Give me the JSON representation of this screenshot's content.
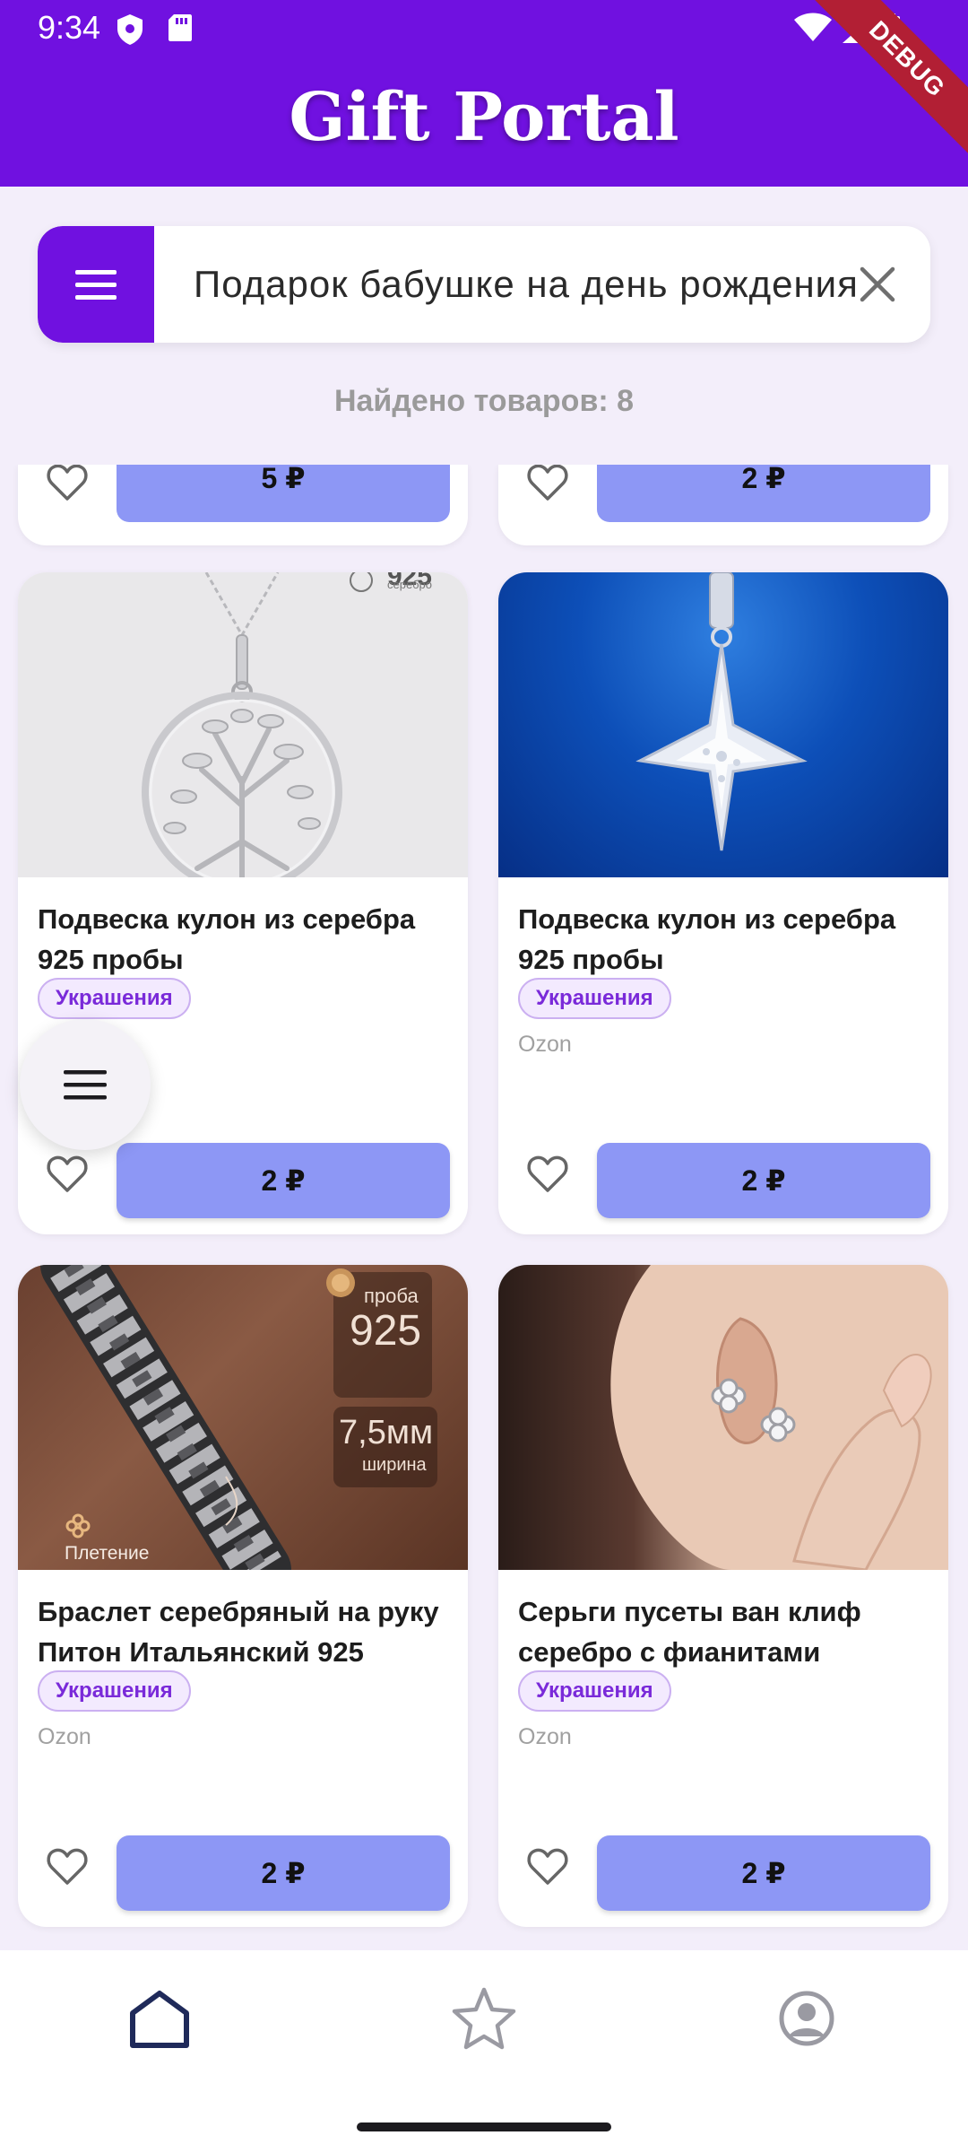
{
  "status_bar": {
    "time": "9:34"
  },
  "app_bar": {
    "title": "Gift Portal",
    "debug_banner": "DEBUG"
  },
  "search": {
    "query": "Подарок бабушке на день рождения"
  },
  "results": {
    "found_text": "Найдено товаров: 8"
  },
  "partial_row": [
    {
      "price": "5 ₽"
    },
    {
      "price": "2 ₽"
    }
  ],
  "products": [
    {
      "name": "Подвеска кулон из серебра 925 пробы",
      "category": "Украшения",
      "store": "",
      "price": "2 ₽",
      "image": "silver-tree-of-life-pendant"
    },
    {
      "name": "Подвеска кулон из серебра 925 пробы",
      "category": "Украшения",
      "store": "Ozon",
      "price": "2 ₽",
      "image": "silver-star-pendant"
    },
    {
      "name": "Браслет серебряный на руку Питон Итальянский 925",
      "category": "Украшения",
      "store": "Ozon",
      "price": "2 ₽",
      "image": "silver-chain-bracelet",
      "overlay": {
        "probe_label": "проба",
        "probe_value": "925",
        "width_value": "7,5мм",
        "width_label": "ширина",
        "weave_label": "Плетение"
      }
    },
    {
      "name": "Серьги пусеты ван клиф серебро с фианитами",
      "category": "Украшения",
      "store": "Ozon",
      "price": "2 ₽",
      "image": "clover-stud-earrings"
    }
  ],
  "card1_overlay": {
    "stamp": "925",
    "stamp_label": "серебро"
  },
  "bottom_nav": [
    "home-icon",
    "star-icon",
    "profile-icon"
  ],
  "colors": {
    "primary": "#7011e0",
    "price_button": "#8d97f5",
    "chip_text": "#7a2ad9",
    "background": "#f3eefa"
  }
}
